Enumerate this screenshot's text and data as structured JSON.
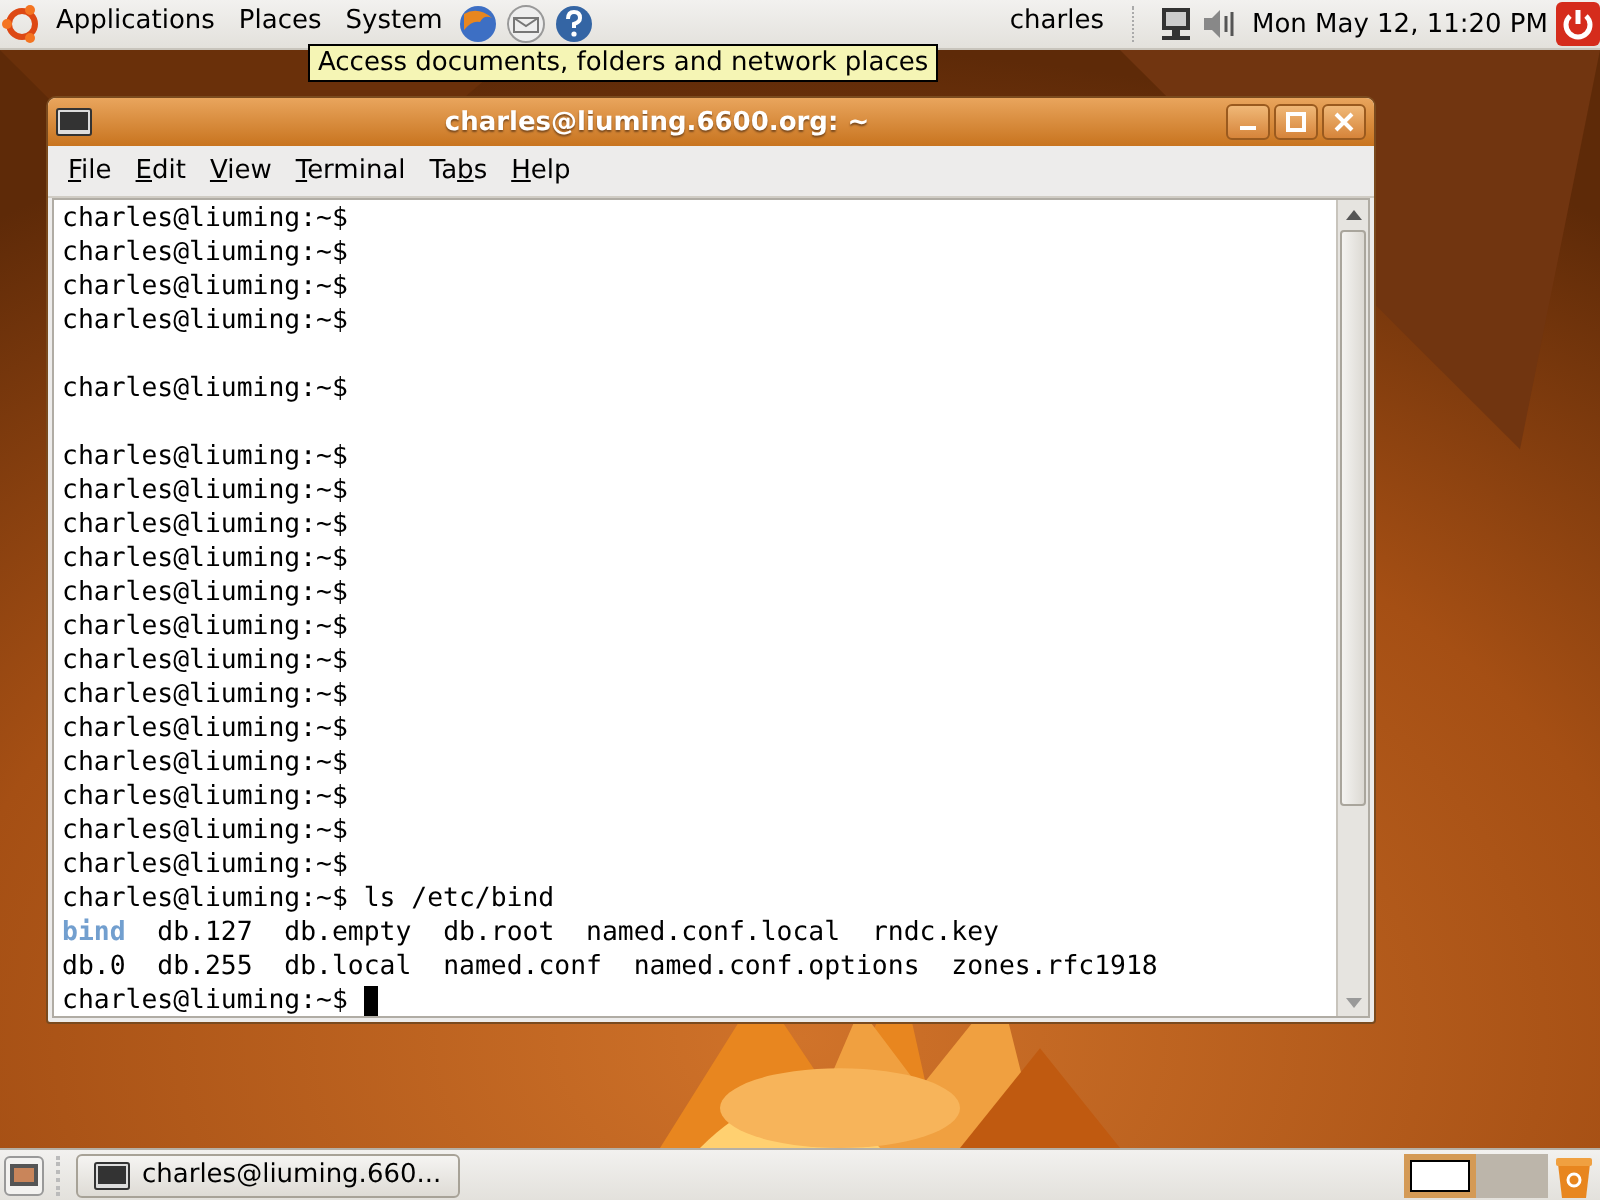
{
  "top_panel": {
    "menus": [
      "Applications",
      "Places",
      "System"
    ],
    "user": "charles",
    "clock": "Mon May 12, 11:20 PM"
  },
  "tooltip": "Access documents, folders and network places",
  "window": {
    "title": "charles@liuming.6600.org: ~",
    "menu": [
      {
        "key": "F",
        "post": "ile"
      },
      {
        "key": "E",
        "post": "dit"
      },
      {
        "key": "V",
        "post": "iew"
      },
      {
        "key": "T",
        "post": "erminal"
      },
      {
        "pre": "Ta",
        "key": "b",
        "post": "s"
      },
      {
        "key": "H",
        "post": "elp"
      }
    ],
    "terminal": [
      {
        "kind": "line",
        "text": "charles@liuming:~$"
      },
      {
        "kind": "line",
        "text": "charles@liuming:~$"
      },
      {
        "kind": "line",
        "text": "charles@liuming:~$"
      },
      {
        "kind": "line",
        "text": "charles@liuming:~$"
      },
      {
        "kind": "blank"
      },
      {
        "kind": "line",
        "text": "charles@liuming:~$"
      },
      {
        "kind": "blank"
      },
      {
        "kind": "line",
        "text": "charles@liuming:~$"
      },
      {
        "kind": "line",
        "text": "charles@liuming:~$"
      },
      {
        "kind": "line",
        "text": "charles@liuming:~$"
      },
      {
        "kind": "line",
        "text": "charles@liuming:~$"
      },
      {
        "kind": "line",
        "text": "charles@liuming:~$"
      },
      {
        "kind": "line",
        "text": "charles@liuming:~$"
      },
      {
        "kind": "line",
        "text": "charles@liuming:~$"
      },
      {
        "kind": "line",
        "text": "charles@liuming:~$"
      },
      {
        "kind": "line",
        "text": "charles@liuming:~$"
      },
      {
        "kind": "line",
        "text": "charles@liuming:~$"
      },
      {
        "kind": "line",
        "text": "charles@liuming:~$"
      },
      {
        "kind": "line",
        "text": "charles@liuming:~$"
      },
      {
        "kind": "line",
        "text": "charles@liuming:~$"
      },
      {
        "kind": "line",
        "text": "charles@liuming:~$ ls /etc/bind"
      },
      {
        "kind": "listing",
        "rows": [
          [
            {
              "text": "bind",
              "directory": true
            },
            {
              "text": "db.127",
              "directory": false
            },
            {
              "text": "db.empty",
              "directory": false
            },
            {
              "text": "db.root",
              "directory": false
            },
            {
              "text": "named.conf.local",
              "directory": false
            },
            {
              "text": "rndc.key",
              "directory": false
            }
          ],
          [
            {
              "text": "db.0",
              "directory": false
            },
            {
              "text": "db.255",
              "directory": false
            },
            {
              "text": "db.local",
              "directory": false
            },
            {
              "text": "named.conf",
              "directory": false
            },
            {
              "text": "named.conf.options",
              "directory": false
            },
            {
              "text": "zones.rfc1918",
              "directory": false
            }
          ]
        ]
      },
      {
        "kind": "line",
        "text": "charles@liuming:~$",
        "cursor": true
      }
    ]
  },
  "taskbar": {
    "tasks": [
      {
        "label": "charles@liuming.660...",
        "selected": false
      }
    ],
    "workspaces": [
      {
        "selected": true
      },
      {
        "selected": false
      }
    ]
  }
}
